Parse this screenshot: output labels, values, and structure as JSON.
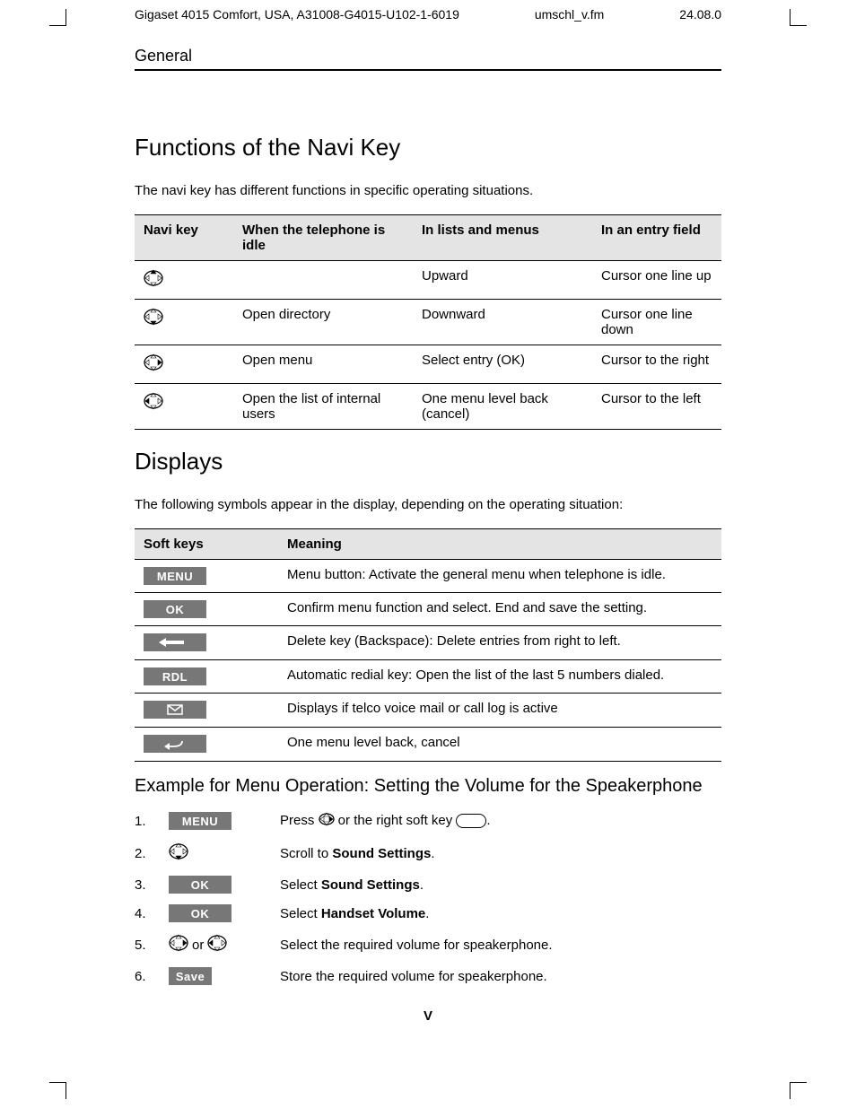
{
  "meta": {
    "left": "Gigaset 4015 Comfort, USA, A31008-G4015-U102-1-6019",
    "center": "umschl_v.fm",
    "right": "24.08.0"
  },
  "section": "General",
  "heading1": "Functions of the Navi Key",
  "intro1": "The navi key has different functions in specific operating situations.",
  "navi_table": {
    "headers": [
      "Navi key",
      "When the tele­phone is idle",
      "In lists and menus",
      "In an entry field"
    ],
    "rows": [
      {
        "dir": "up",
        "idle": "",
        "list": "Upward",
        "entry": "Cursor one line up"
      },
      {
        "dir": "down",
        "idle": "Open directory",
        "list": "Downward",
        "entry": "Cursor one line down"
      },
      {
        "dir": "right",
        "idle": "Open menu",
        "list": "Select entry (OK)",
        "entry": "Cursor to the right"
      },
      {
        "dir": "left",
        "idle": "Open the list of inter­nal users",
        "list": "One menu level back (cancel)",
        "entry": "Cursor to the left"
      }
    ]
  },
  "heading2": "Displays",
  "intro2": "The following symbols appear in the display, depending on the operating situation:",
  "soft_table": {
    "headers": [
      "Soft keys",
      "Meaning"
    ],
    "rows": [
      {
        "key_type": "text",
        "key": "MENU",
        "meaning": "Menu button: Activate the general menu when telephone is idle."
      },
      {
        "key_type": "text",
        "key": "OK",
        "meaning": "Confirm menu function and select. End and save the setting."
      },
      {
        "key_type": "icon",
        "key": "backspace",
        "meaning": "Delete key (Backspace): Delete entries from right to left."
      },
      {
        "key_type": "text",
        "key": "RDL",
        "meaning": "Automatic redial key: Open the list of the last 5 numbers dialed."
      },
      {
        "key_type": "icon",
        "key": "mail",
        "meaning": "Displays if telco voice mail or call log is active"
      },
      {
        "key_type": "icon",
        "key": "back",
        "meaning": "One menu level back, cancel"
      }
    ]
  },
  "heading3": "Example for Menu Operation: Setting the Volume for the Speakerphone",
  "steps": [
    {
      "key": {
        "type": "soft",
        "label": "MENU"
      },
      "text_pre": "Press ",
      "text_mid": " or the right soft key ",
      "text_post": ".",
      "bold": "",
      "has_navi": true,
      "has_oval": true
    },
    {
      "key": {
        "type": "navi",
        "dir": "down"
      },
      "text_pre": "Scroll to ",
      "bold": "Sound Settings",
      "text_post": "."
    },
    {
      "key": {
        "type": "soft",
        "label": "OK"
      },
      "text_pre": "Select ",
      "bold": "Sound Settings",
      "text_post": "."
    },
    {
      "key": {
        "type": "soft",
        "label": "OK"
      },
      "text_pre": "Select ",
      "bold": "Handset Volume",
      "text_post": "."
    },
    {
      "key": {
        "type": "navi_pair"
      },
      "text_pre": "Select the required volume for speakerphone.",
      "bold": "",
      "text_post": "",
      "or": " or "
    },
    {
      "key": {
        "type": "soft",
        "label": "Save",
        "tight": true
      },
      "text_pre": "Store the required volume for speakerphone.",
      "bold": "",
      "text_post": ""
    }
  ],
  "page_number": "V"
}
